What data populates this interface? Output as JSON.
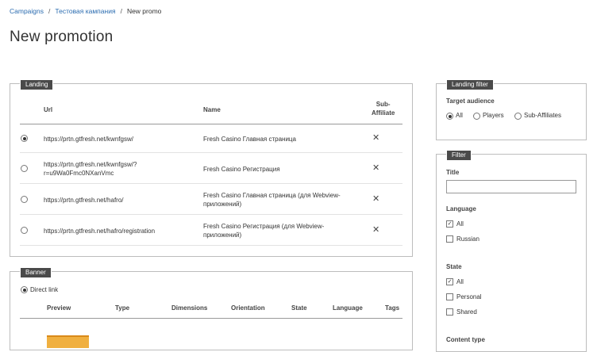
{
  "breadcrumb": {
    "item1": "Campaigns",
    "item2": "Тестовая кампания",
    "current": "New promo",
    "separator": "/"
  },
  "page_title": "New promotion",
  "landing": {
    "legend": "Landing",
    "headers": {
      "url": "Url",
      "name": "Name",
      "sub_affiliate_line1": "Sub-",
      "sub_affiliate_line2": "Affiliate"
    },
    "rows": [
      {
        "url1": "https://prtn.gtfresh.net/kwnfgsw/",
        "url2": "",
        "name1": "Fresh Casino Главная страница",
        "name2": "",
        "sub": "✕",
        "selected": true
      },
      {
        "url1": "https://prtn.gtfresh.net/kwnfgsw/?",
        "url2": "r=u9Wa0Fmc0NXanVmc",
        "name1": "Fresh Casino Регистрация",
        "name2": "",
        "sub": "✕",
        "selected": false
      },
      {
        "url1": "https://prtn.gtfresh.net/hafro/",
        "url2": "",
        "name1": "Fresh Casino Главная страница (для Webview-",
        "name2": "приложений)",
        "sub": "✕",
        "selected": false
      },
      {
        "url1": "https://prtn.gtfresh.net/hafro/registration",
        "url2": "",
        "name1": "Fresh Casino Регистрация (для Webview-",
        "name2": "приложений)",
        "sub": "✕",
        "selected": false
      }
    ]
  },
  "banner": {
    "legend": "Banner",
    "direct_link": "Direct link",
    "headers": {
      "preview": "Preview",
      "type": "Type",
      "dimensions": "Dimensions",
      "orientation": "Orientation",
      "state": "State",
      "language": "Language",
      "tags": "Tags"
    }
  },
  "landing_filter": {
    "legend": "Landing filter",
    "title": "Target audience",
    "options": {
      "all": "All",
      "players": "Players",
      "sub_affiliates": "Sub-Affiliates"
    },
    "selected": "All"
  },
  "filter": {
    "legend": "Filter",
    "title_label": "Title",
    "title_value": "",
    "language_label": "Language",
    "language_options": {
      "all": "All",
      "russian": "Russian"
    },
    "state_label": "State",
    "state_options": {
      "all": "All",
      "personal": "Personal",
      "shared": "Shared"
    },
    "content_type_label": "Content type"
  },
  "icons": {
    "checked": "check-icon",
    "remove": "cross-icon"
  }
}
